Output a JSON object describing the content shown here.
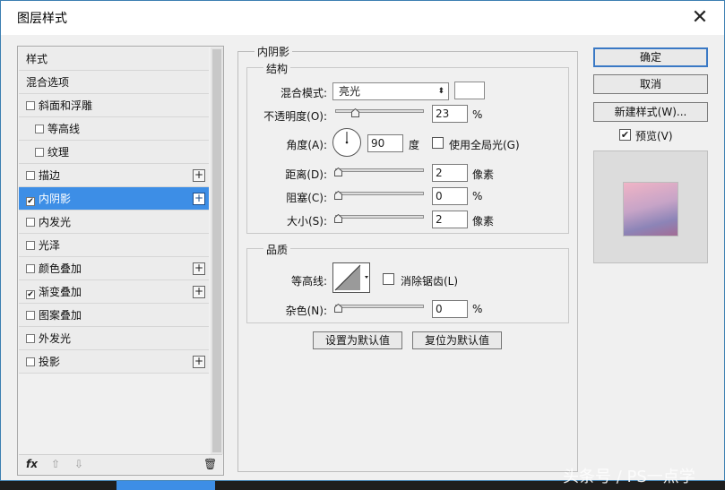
{
  "dialog": {
    "title": "图层样式"
  },
  "styles_list": [
    {
      "label": "样式",
      "checkbox": false,
      "checked": false,
      "indent": false,
      "plus": false,
      "selected": false
    },
    {
      "label": "混合选项",
      "checkbox": false,
      "checked": false,
      "indent": false,
      "plus": false,
      "selected": false
    },
    {
      "label": "斜面和浮雕",
      "checkbox": true,
      "checked": false,
      "indent": false,
      "plus": false,
      "selected": false
    },
    {
      "label": "等高线",
      "checkbox": true,
      "checked": false,
      "indent": true,
      "plus": false,
      "selected": false
    },
    {
      "label": "纹理",
      "checkbox": true,
      "checked": false,
      "indent": true,
      "plus": false,
      "selected": false
    },
    {
      "label": "描边",
      "checkbox": true,
      "checked": false,
      "indent": false,
      "plus": true,
      "selected": false
    },
    {
      "label": "内阴影",
      "checkbox": true,
      "checked": true,
      "indent": false,
      "plus": true,
      "selected": true
    },
    {
      "label": "内发光",
      "checkbox": true,
      "checked": false,
      "indent": false,
      "plus": false,
      "selected": false
    },
    {
      "label": "光泽",
      "checkbox": true,
      "checked": false,
      "indent": false,
      "plus": false,
      "selected": false
    },
    {
      "label": "颜色叠加",
      "checkbox": true,
      "checked": false,
      "indent": false,
      "plus": true,
      "selected": false
    },
    {
      "label": "渐变叠加",
      "checkbox": true,
      "checked": true,
      "indent": false,
      "plus": true,
      "selected": false
    },
    {
      "label": "图案叠加",
      "checkbox": true,
      "checked": false,
      "indent": false,
      "plus": false,
      "selected": false
    },
    {
      "label": "外发光",
      "checkbox": true,
      "checked": false,
      "indent": false,
      "plus": false,
      "selected": false
    },
    {
      "label": "投影",
      "checkbox": true,
      "checked": false,
      "indent": false,
      "plus": true,
      "selected": false
    }
  ],
  "footer": {
    "fx": "fx",
    "up": "⇧",
    "down": "⇩",
    "trash": "🗑"
  },
  "inner_shadow": {
    "section_title": "内阴影",
    "structure_title": "结构",
    "blend_mode_label": "混合模式:",
    "blend_mode_value": "亮光",
    "blend_color": "#ffffff",
    "opacity_label": "不透明度(O):",
    "opacity_value": "23",
    "opacity_level": 0.23,
    "opacity_unit": "%",
    "angle_label": "角度(A):",
    "angle_value": "90",
    "angle_unit": "度",
    "global_light_label": "使用全局光(G)",
    "global_light_checked": false,
    "distance_label": "距离(D):",
    "distance_value": "2",
    "distance_unit": "像素",
    "choke_label": "阻塞(C):",
    "choke_value": "0",
    "choke_unit": "%",
    "size_label": "大小(S):",
    "size_value": "2",
    "size_unit": "像素",
    "quality_title": "品质",
    "contour_label": "等高线:",
    "antialias_label": "消除锯齿(L)",
    "noise_label": "杂色(N):",
    "noise_value": "0",
    "noise_unit": "%",
    "set_default_label": "设置为默认值",
    "reset_default_label": "复位为默认值"
  },
  "actions": {
    "ok_label": "确定",
    "cancel_label": "取消",
    "new_style_label": "新建样式(W)...",
    "preview_label": "预览(V)",
    "preview_checked": true
  },
  "watermark": "头条号 / PS一点学"
}
